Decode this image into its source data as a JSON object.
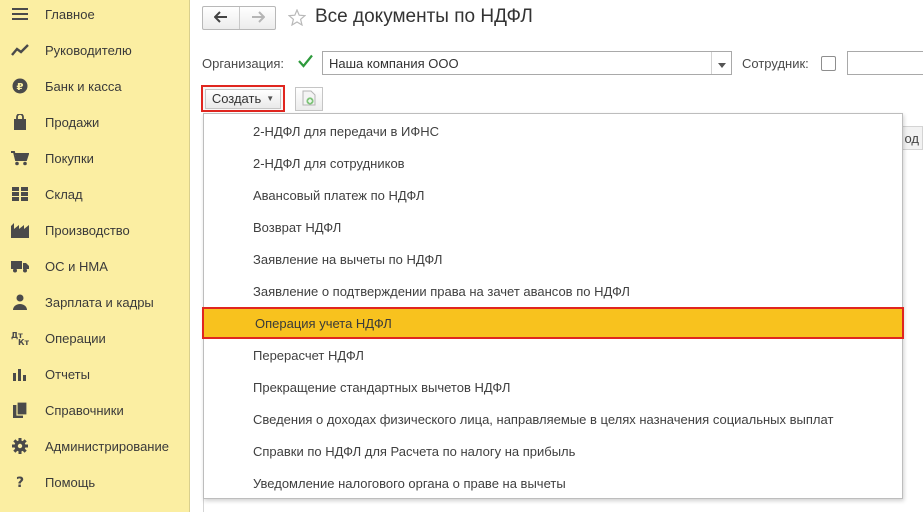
{
  "sidebar": {
    "items": [
      {
        "label": "Главное",
        "icon": "menu-lines-icon"
      },
      {
        "label": "Руководителю",
        "icon": "trend-chart-icon"
      },
      {
        "label": "Банк и касса",
        "icon": "ruble-coin-icon"
      },
      {
        "label": "Продажи",
        "icon": "shopping-bag-icon"
      },
      {
        "label": "Покупки",
        "icon": "shopping-cart-icon"
      },
      {
        "label": "Склад",
        "icon": "warehouse-grid-icon"
      },
      {
        "label": "Производство",
        "icon": "factory-icon"
      },
      {
        "label": "ОС и НМА",
        "icon": "truck-icon"
      },
      {
        "label": "Зарплата и кадры",
        "icon": "person-icon"
      },
      {
        "label": "Операции",
        "icon": "debit-credit-icon"
      },
      {
        "label": "Отчеты",
        "icon": "bar-chart-icon"
      },
      {
        "label": "Справочники",
        "icon": "books-icon"
      },
      {
        "label": "Администрирование",
        "icon": "gear-icon"
      },
      {
        "label": "Помощь",
        "icon": "question-icon"
      }
    ]
  },
  "header": {
    "title": "Все документы по НДФЛ"
  },
  "filters": {
    "organization_label": "Организация:",
    "organization_checked": true,
    "organization_value": "Наша компания ООО",
    "employee_label": "Сотрудник:",
    "employee_checked": false,
    "employee_value": ""
  },
  "toolbar": {
    "create_label": "Создать"
  },
  "table": {
    "header_partial": "од"
  },
  "create_menu": {
    "selected_index": 6,
    "items": [
      "2-НДФЛ для передачи в ИФНС",
      "2-НДФЛ для сотрудников",
      "Авансовый платеж по НДФЛ",
      "Возврат НДФЛ",
      "Заявление на вычеты по НДФЛ",
      "Заявление о подтверждении права на зачет авансов по НДФЛ",
      "Операция учета НДФЛ",
      "Перерасчет НДФЛ",
      "Прекращение стандартных вычетов НДФЛ",
      "Сведения о доходах физического лица, направляемые в целях назначения социальных выплат",
      "Справки по НДФЛ для Расчета по налогу на прибыль",
      "Уведомление налогового органа о праве на вычеты"
    ]
  },
  "colors": {
    "sidebar_bg": "#fbeea2",
    "highlight": "#f8c21e",
    "callout_border": "#e0261f",
    "check": "#2e9a3c"
  }
}
